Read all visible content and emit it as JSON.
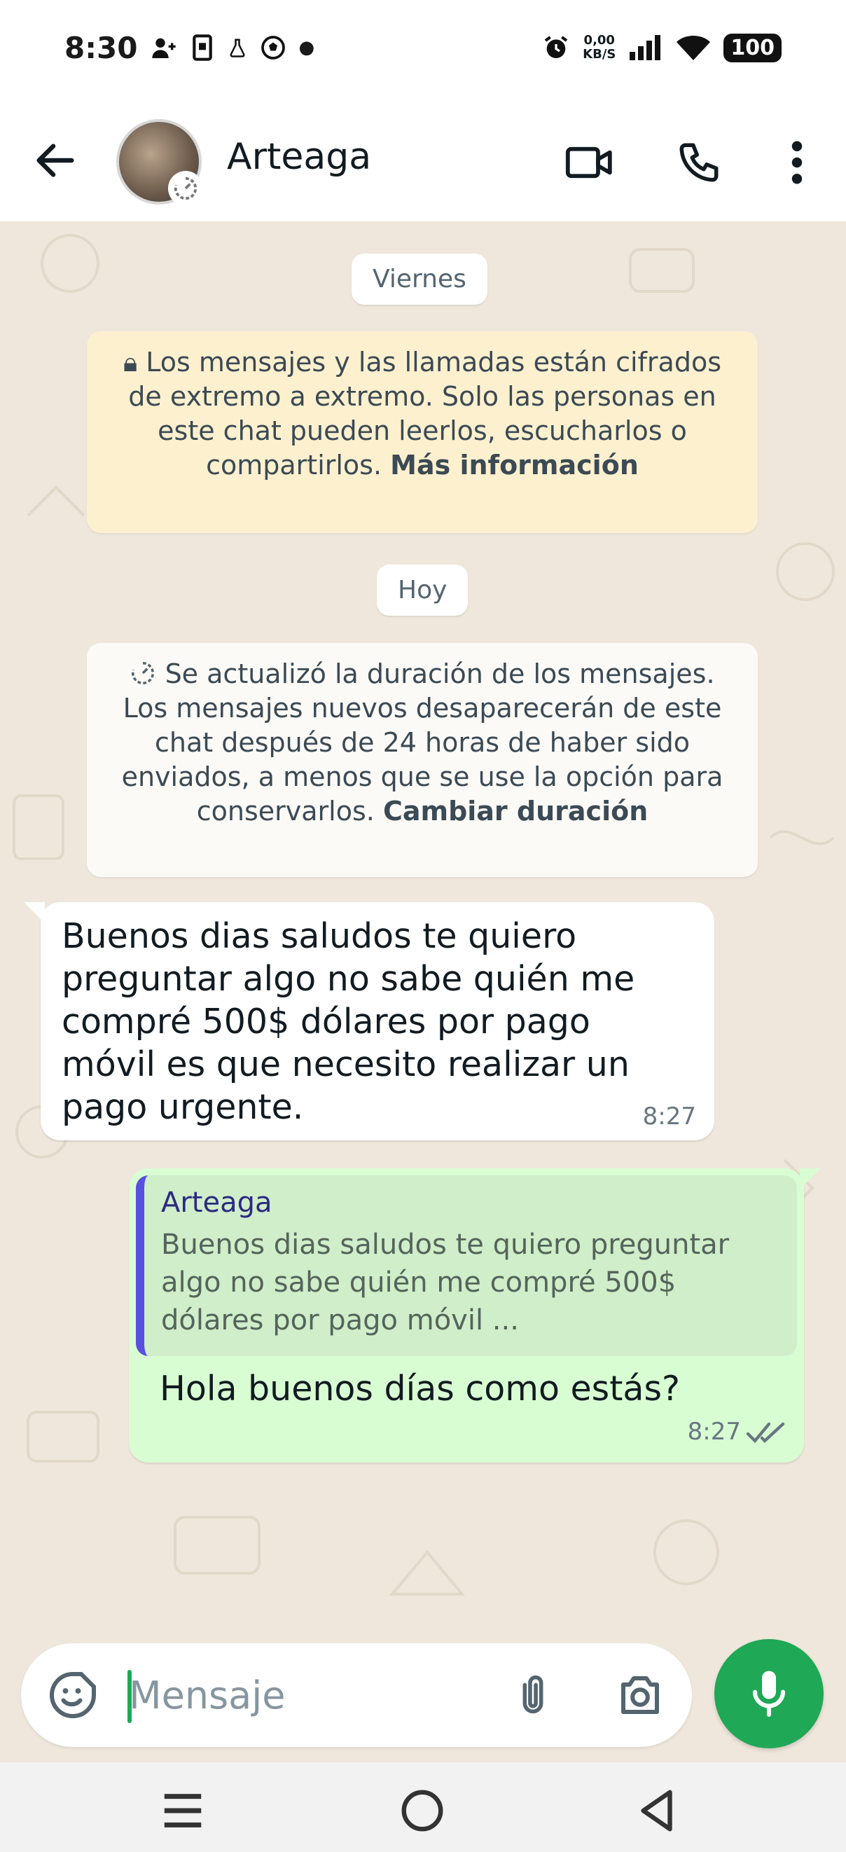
{
  "status_bar": {
    "time": "8:30",
    "net_speed_value": "0,00",
    "net_speed_unit": "KB/S",
    "battery": "100"
  },
  "header": {
    "contact_name": "Arteaga"
  },
  "chat": {
    "date_chip_1": "Viernes",
    "encryption_notice": "Los mensajes y las llamadas están cifrados de extremo a extremo. Solo las personas en este chat pueden leerlos, escucharlos o compartirlos.",
    "encryption_link": "Más información",
    "date_chip_2": "Hoy",
    "disappearing_notice": "Se actualizó la duración de los mensajes. Los mensajes nuevos desaparecerán de este chat después de 24 horas de haber sido enviados, a menos que se use la opción para conservarlos.",
    "disappearing_link": "Cambiar duración",
    "messages": [
      {
        "direction": "incoming",
        "text": "Buenos dias saludos te quiero preguntar algo no sabe quién me compré 500$ dólares por pago móvil es que necesito realizar un pago urgente.",
        "time": "8:27"
      },
      {
        "direction": "outgoing",
        "quote_author": "Arteaga",
        "quote_text": "Buenos dias saludos te quiero preguntar algo no sabe quién me compré 500$ dólares por pago móvil ...",
        "text": "Hola buenos días como estás?",
        "time": "8:27"
      }
    ]
  },
  "composer": {
    "placeholder": "Mensaje"
  },
  "colors": {
    "accent_green": "#1fa855",
    "outgoing_bubble": "#d9fdd3",
    "quote_bar": "#5a4fe0"
  }
}
